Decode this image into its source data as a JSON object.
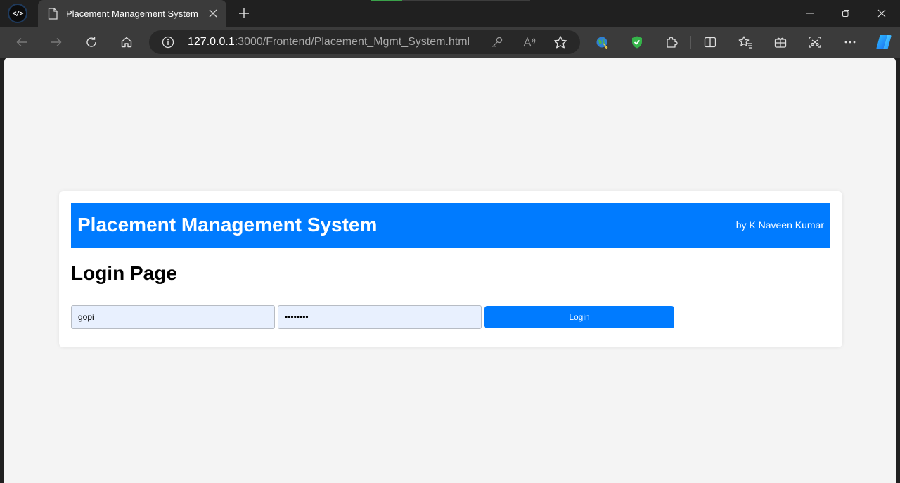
{
  "browser": {
    "tab": {
      "title": "Placement Management System",
      "icon": "page-icon"
    },
    "address": {
      "host": "127.0.0.1",
      "rest": ":3000/Frontend/Placement_Mgmt_System.html"
    },
    "colors": {
      "frame": "#202020",
      "toolbar": "#3b3b3b",
      "address_bg": "#282828"
    }
  },
  "app": {
    "title": "Placement Management System",
    "author": "by K Naveen Kumar",
    "heading": "Login Page",
    "form": {
      "username_value": "gopi",
      "password_value": "password",
      "login_label": "Login"
    },
    "colors": {
      "accent": "#007bff",
      "input_bg": "#e8f0fe",
      "page_bg": "#f4f4f4"
    }
  }
}
